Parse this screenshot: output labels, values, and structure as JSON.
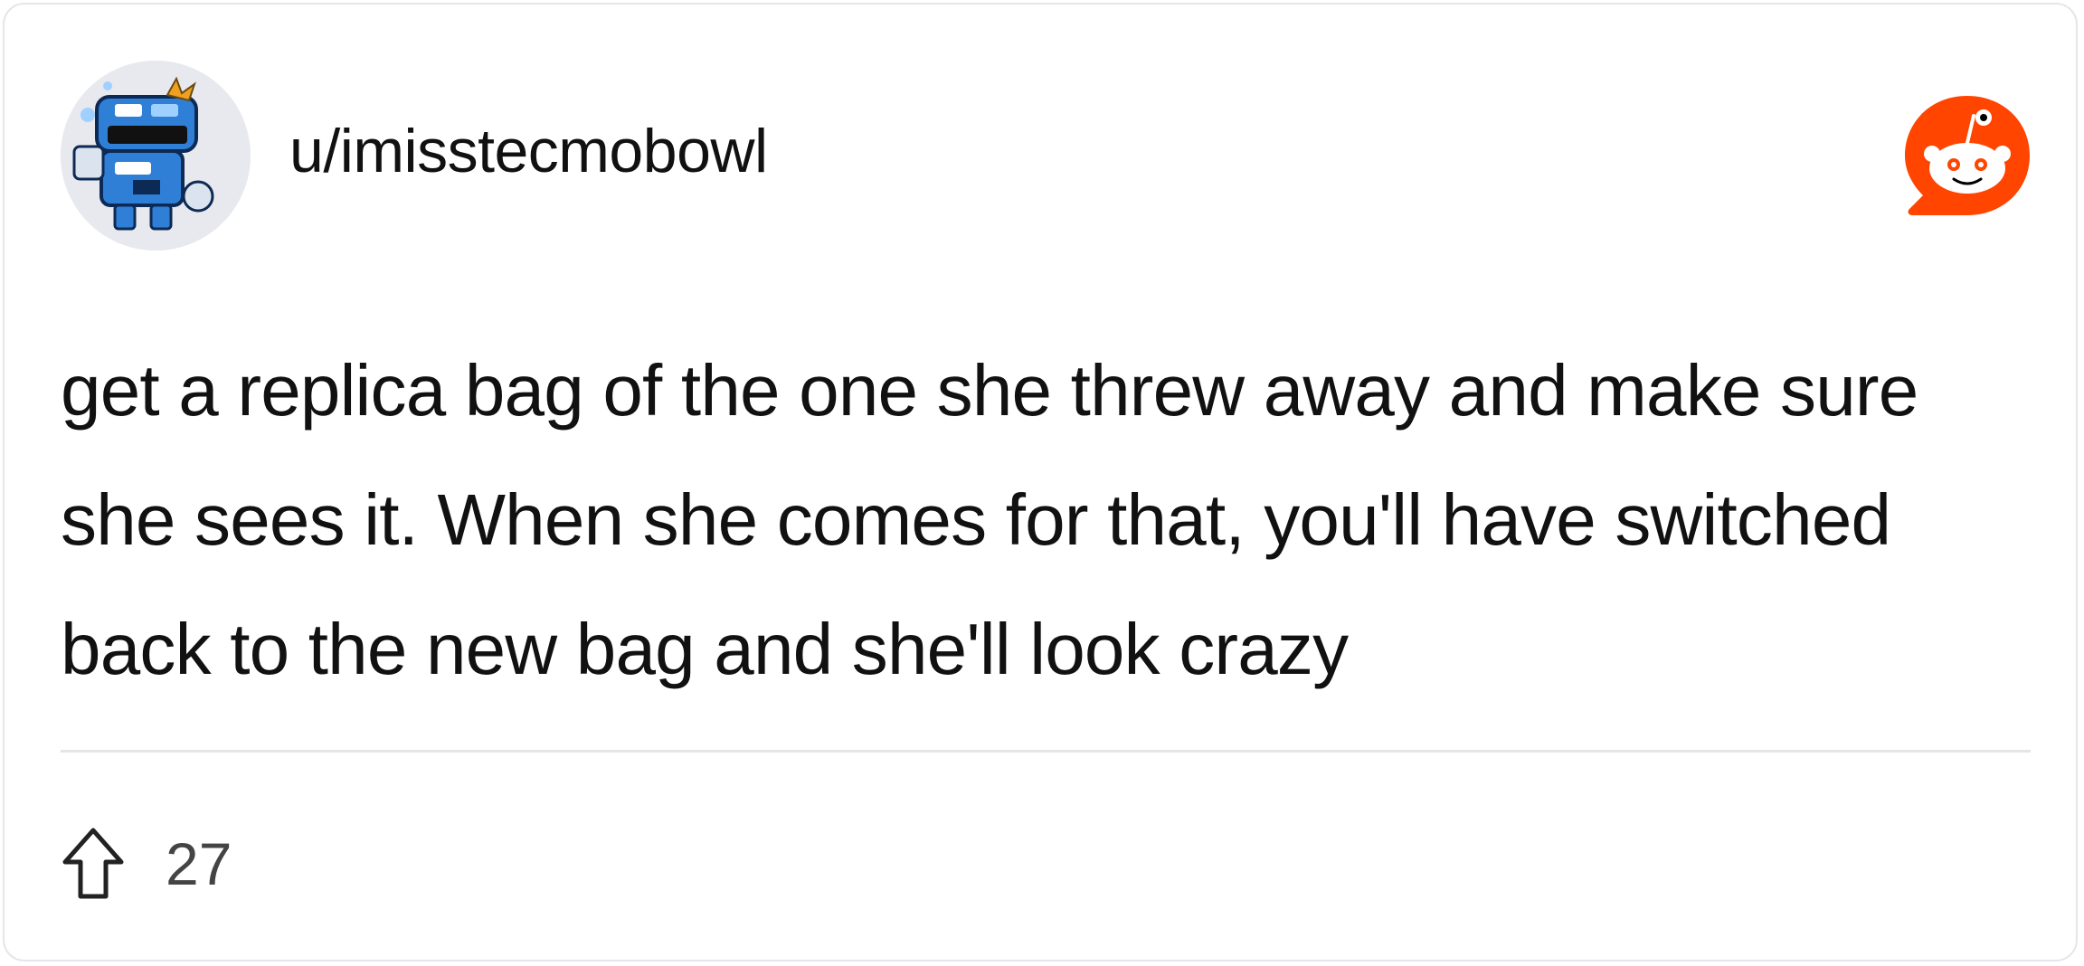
{
  "post": {
    "username": "u/imisstecmobowl",
    "body": "get a replica bag of the one she threw away and make sure she sees it. When she comes for that, you'll have switched back to the new bag and she'll look crazy",
    "upvotes": "27"
  },
  "icons": {
    "avatar": "snoo-avatar-icon",
    "logo": "reddit-logo-icon",
    "upvote": "upvote-arrow-icon"
  },
  "colors": {
    "reddit_orange": "#ff4500",
    "text": "#111111",
    "muted": "#444444",
    "border": "#e6e6e6"
  }
}
